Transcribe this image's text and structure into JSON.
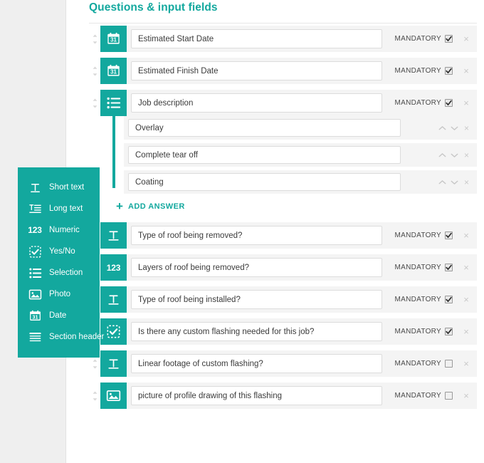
{
  "header": {
    "title": "Questions & input fields"
  },
  "colors": {
    "accent": "#13a89e",
    "row_background": "#f4f4f4",
    "gutter": "#efefef",
    "input_background": "#ffffff",
    "text": "#3b3b3b"
  },
  "questions": [
    {
      "icon": "date-icon",
      "label": "Estimated Start Date",
      "mandatory_label": "MANDATORY",
      "mandatory_checked": true,
      "close_label": "×"
    },
    {
      "icon": "date-icon",
      "label": "Estimated Finish Date",
      "mandatory_label": "MANDATORY",
      "mandatory_checked": true,
      "close_label": "×"
    },
    {
      "icon": "selection-icon",
      "label": "Job description",
      "mandatory_label": "MANDATORY",
      "mandatory_checked": true,
      "close_label": "×"
    },
    {
      "icon": "short-text-icon",
      "label": "Type of roof being removed?",
      "mandatory_label": "MANDATORY",
      "mandatory_checked": true,
      "close_label": "×"
    },
    {
      "icon": "numeric-icon",
      "label": "Layers of roof being removed?",
      "mandatory_label": "MANDATORY",
      "mandatory_checked": true,
      "close_label": "×"
    },
    {
      "icon": "short-text-icon",
      "label": "Type of roof being installed?",
      "mandatory_label": "MANDATORY",
      "mandatory_checked": true,
      "close_label": "×"
    },
    {
      "icon": "yes-no-icon",
      "label": "Is there any custom flashing needed for this job?",
      "mandatory_label": "MANDATORY",
      "mandatory_checked": true,
      "close_label": "×"
    },
    {
      "icon": "short-text-icon",
      "label": "Linear footage of custom flashing?",
      "mandatory_label": "MANDATORY",
      "mandatory_checked": false,
      "close_label": "×"
    },
    {
      "icon": "photo-icon",
      "label": "picture of profile drawing of this flashing",
      "mandatory_label": "MANDATORY",
      "mandatory_checked": false,
      "close_label": "×"
    }
  ],
  "answers": {
    "items": [
      {
        "label": "Overlay"
      },
      {
        "label": "Complete tear off"
      },
      {
        "label": "Coating"
      }
    ],
    "add_label": "ADD ANSWER",
    "add_plus": "+",
    "close_label": "×"
  },
  "palette": {
    "items": [
      {
        "icon": "short-text-icon",
        "label": "Short text"
      },
      {
        "icon": "long-text-icon",
        "label": "Long text"
      },
      {
        "icon": "numeric-icon",
        "label": "Numeric",
        "glyph": "123"
      },
      {
        "icon": "yes-no-icon",
        "label": "Yes/No"
      },
      {
        "icon": "selection-icon",
        "label": "Selection"
      },
      {
        "icon": "photo-icon",
        "label": "Photo"
      },
      {
        "icon": "date-icon",
        "label": "Date",
        "glyph": "31"
      },
      {
        "icon": "section-header-icon",
        "label": "Section header"
      }
    ]
  }
}
